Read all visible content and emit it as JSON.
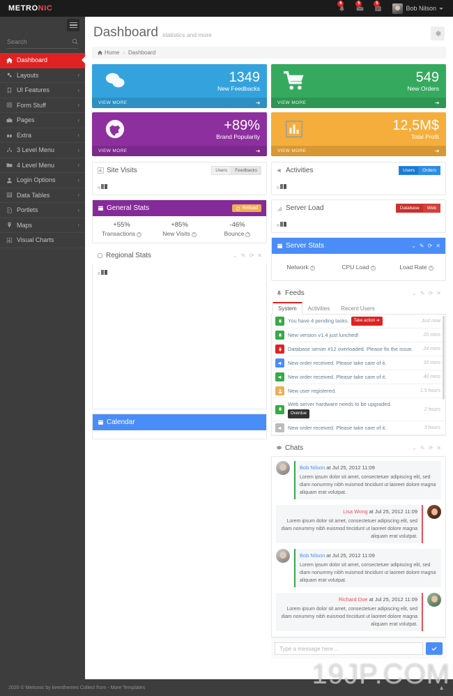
{
  "header": {
    "brand_main": "METRO",
    "brand_accent": "NIC",
    "notifications_badge": "6",
    "inbox_badge": "5",
    "tasks_badge": "5",
    "user_name": "Bob Nilson"
  },
  "sidebar": {
    "search_placeholder": "Search",
    "items": [
      {
        "label": "Dashboard",
        "icon": "home-icon",
        "arrow": "",
        "active": true
      },
      {
        "label": "Layouts",
        "icon": "cogs-icon",
        "arrow": "‹"
      },
      {
        "label": "UI Features",
        "icon": "bookmark-icon",
        "arrow": "‹"
      },
      {
        "label": "Form Stuff",
        "icon": "table-icon",
        "arrow": "‹"
      },
      {
        "label": "Pages",
        "icon": "briefcase-icon",
        "arrow": "‹"
      },
      {
        "label": "Extra",
        "icon": "gift-icon",
        "arrow": "‹"
      },
      {
        "label": "3 Level Menu",
        "icon": "sitemap-icon",
        "arrow": "‹"
      },
      {
        "label": "4 Level Menu",
        "icon": "folder-icon",
        "arrow": "‹"
      },
      {
        "label": "Login Options",
        "icon": "user-icon",
        "arrow": "‹"
      },
      {
        "label": "Data Tables",
        "icon": "grid-icon",
        "arrow": "‹"
      },
      {
        "label": "Portlets",
        "icon": "file-icon",
        "arrow": "‹"
      },
      {
        "label": "Maps",
        "icon": "map-pin-icon",
        "arrow": "‹"
      },
      {
        "label": "Visual Charts",
        "icon": "bar-chart-icon",
        "arrow": ""
      }
    ]
  },
  "page": {
    "title": "Dashboard",
    "subtitle": "statistics and more",
    "breadcrumb": {
      "home": "Home",
      "separator": "›",
      "current": "Dashboard"
    }
  },
  "tiles": [
    {
      "number": "1349",
      "desc": "New Feedbacks",
      "more": "VIEW MORE",
      "color": "#34a3dd",
      "icon": "comments-icon"
    },
    {
      "number": "549",
      "desc": "New Orders",
      "more": "VIEW MORE",
      "color": "#35aa5f",
      "icon": "shopping-cart-icon"
    },
    {
      "number": "+89%",
      "desc": "Brand Popularity",
      "more": "VIEW MORE",
      "color": "#8e2fa0",
      "icon": "globe-icon"
    },
    {
      "number": "12,5M$",
      "desc": "Total Profit",
      "more": "VIEW MORE",
      "color": "#f5ae3c",
      "icon": "bar-chart-icon"
    }
  ],
  "portlets": {
    "site_visits": {
      "title": "Site Visits",
      "icon": "chart-icon",
      "buttons": [
        "Users",
        "Feedbacks"
      ],
      "selected": "Feedbacks"
    },
    "activities": {
      "title": "Activities",
      "icon": "bullhorn-icon",
      "buttons": [
        "Users",
        "Orders"
      ],
      "selected": "Users"
    },
    "server_load": {
      "title": "Server Load",
      "icon": "signal-icon",
      "buttons": [
        "Database",
        "Web"
      ],
      "selected": "Database"
    },
    "general_stats": {
      "title": "General Stats",
      "icon": "calendar-icon",
      "reload_label": "Reload",
      "stats": [
        {
          "value": "+55%",
          "label": "Transactions"
        },
        {
          "value": "+85%",
          "label": "New Visits"
        },
        {
          "value": "-46%",
          "label": "Bounce"
        }
      ]
    },
    "server_stats": {
      "title": "Server Stats",
      "icon": "calendar-icon",
      "stats": [
        {
          "label": "Network"
        },
        {
          "label": "CPU Load"
        },
        {
          "label": "Load Rate"
        }
      ]
    },
    "regional_stats": {
      "title": "Regional Stats",
      "icon": "globe-small-icon"
    },
    "calendar": {
      "title": "Calendar",
      "icon": "calendar-icon"
    },
    "feeds": {
      "title": "Feeds",
      "icon": "bell-icon"
    },
    "chats": {
      "title": "Chats",
      "icon": "chat-icon"
    }
  },
  "feeds": {
    "tabs": [
      "System",
      "Activities",
      "Recent Users"
    ],
    "active_tab": "System",
    "items": [
      {
        "icon": "bell-icon",
        "color": "f-green",
        "text": "You have 4 pending tasks.",
        "action": "Take action",
        "time": "Just now"
      },
      {
        "icon": "bell-icon",
        "color": "f-green",
        "text": "New version v1.4 just lunched!",
        "time": "20 mins"
      },
      {
        "icon": "plug-icon",
        "color": "f-red",
        "text": "Database server #12 overloaded. Please fix the issue.",
        "time": "24 mins"
      },
      {
        "icon": "bullhorn-icon",
        "color": "f-blue",
        "text": "New order received. Please take care of it.",
        "time": "30 mins"
      },
      {
        "icon": "bullhorn-icon",
        "color": "f-green",
        "text": "New order received. Please take care of it.",
        "time": "40 mins"
      },
      {
        "icon": "user-icon",
        "color": "f-yellow",
        "text": "New user registered.",
        "time": "1.5 hours"
      },
      {
        "icon": "bell-icon",
        "color": "f-green",
        "text": "Web server hardware needs to be upgraded.",
        "badge": "Overdue",
        "time": "2 hours"
      },
      {
        "icon": "bullhorn-icon",
        "color": "f-grey",
        "text": "New order received. Please take care of it.",
        "time": "3 hours"
      }
    ]
  },
  "chats": {
    "messages": [
      {
        "dir": "in",
        "name": "Bob Nilson",
        "when": "at Jul 25, 2012 11:09",
        "avatar": "av-bob",
        "text": "Lorem ipsum dolor sit amet, consectetuer adipiscing elit, sed diam nonummy nibh euismod tincidunt ut laoreet dolore magna aliquam erat volutpat."
      },
      {
        "dir": "out",
        "name": "Lisa Wong",
        "when": "at Jul 25, 2012 11:09",
        "avatar": "av-lisa",
        "text": "Lorem ipsum dolor sit amet, consectetuer adipiscing elit, sed diam nonummy nibh euismod tincidunt ut laoreet dolore magna aliquam erat volutpat."
      },
      {
        "dir": "in",
        "name": "Bob Nilson",
        "when": "at Jul 25, 2012 11:09",
        "avatar": "av-bob",
        "text": "Lorem ipsum dolor sit amet, consectetuer adipiscing elit, sed diam nonummy nibh euismod tincidunt ut laoreet dolore magna aliquam erat volutpat."
      },
      {
        "dir": "out",
        "name": "Richard Doe",
        "when": "at Jul 25, 2012 11:09",
        "avatar": "av-rich",
        "text": "Lorem ipsum dolor sit amet, consectetuer adipiscing elit, sed diam nonummy nibh euismod tincidunt ut laoreet dolore magna aliquam erat volutpat."
      }
    ],
    "input_placeholder": "Type a message here...",
    "send_icon": "check-icon"
  },
  "footer": {
    "text": "2020 © Metronic by keenthemes Collect from - More Templates",
    "go_top": "▲"
  },
  "watermark": "19JP.COM",
  "colors": {
    "sidebar_bg": "#3d3d3d",
    "topbar_bg": "#1b1b1b",
    "accent_red": "#e02222",
    "blue": "#4b8df8",
    "green": "#35aa47",
    "purple": "#852b99",
    "yellow": "#f0ad4e"
  }
}
